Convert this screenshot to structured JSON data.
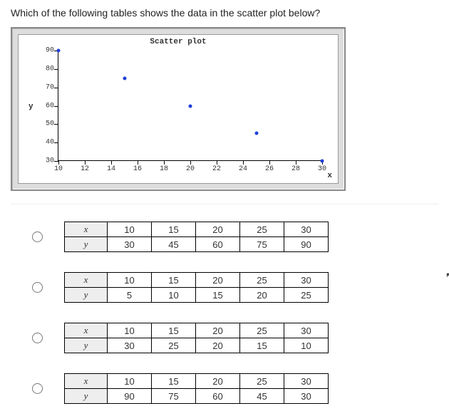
{
  "question": "Which of the following tables shows the data in the scatter plot below?",
  "chart_data": {
    "type": "scatter",
    "title": "Scatter plot",
    "xlabel": "x",
    "ylabel": "y",
    "xlim": [
      10,
      30
    ],
    "ylim": [
      30,
      90
    ],
    "x_ticks": [
      10,
      12,
      14,
      16,
      18,
      20,
      22,
      24,
      26,
      28,
      30
    ],
    "y_ticks": [
      30,
      40,
      50,
      60,
      70,
      80,
      90
    ],
    "x": [
      10,
      15,
      20,
      25,
      30
    ],
    "y": [
      90,
      75,
      60,
      45,
      30
    ]
  },
  "options": [
    {
      "rows": [
        {
          "label": "x",
          "values": [
            10,
            15,
            20,
            25,
            30
          ]
        },
        {
          "label": "y",
          "values": [
            30,
            45,
            60,
            75,
            90
          ]
        }
      ]
    },
    {
      "rows": [
        {
          "label": "x",
          "values": [
            10,
            15,
            20,
            25,
            30
          ]
        },
        {
          "label": "y",
          "values": [
            5,
            10,
            15,
            20,
            25
          ]
        }
      ]
    },
    {
      "rows": [
        {
          "label": "x",
          "values": [
            10,
            15,
            20,
            25,
            30
          ]
        },
        {
          "label": "y",
          "values": [
            30,
            25,
            20,
            15,
            10
          ]
        }
      ]
    },
    {
      "rows": [
        {
          "label": "x",
          "values": [
            10,
            15,
            20,
            25,
            30
          ]
        },
        {
          "label": "y",
          "values": [
            90,
            75,
            60,
            45,
            30
          ]
        }
      ]
    }
  ]
}
